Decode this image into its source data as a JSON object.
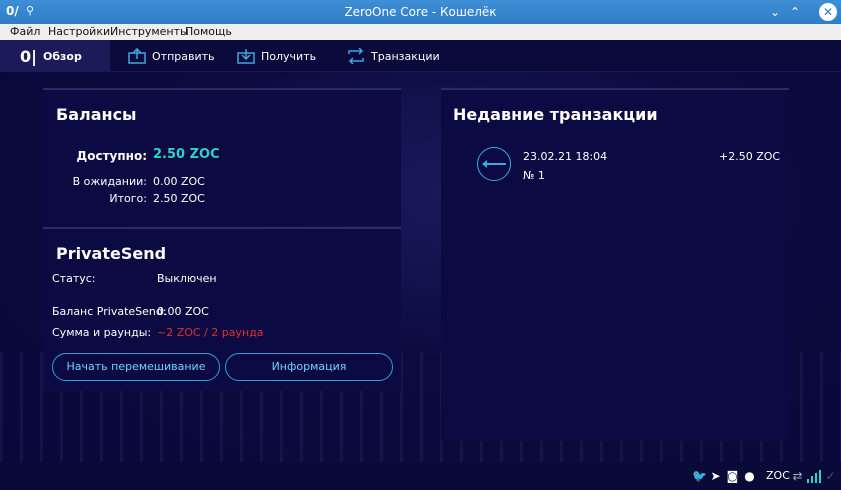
{
  "window": {
    "title": "ZeroOne Core - Кошелёк",
    "app_icon": "0/",
    "pin_icon": "pin-icon",
    "controls": [
      "minimize-icon",
      "maximize-icon",
      "close-icon"
    ]
  },
  "menu": {
    "items": [
      "Файл",
      "Настройки",
      "Инструменты",
      "Помощь"
    ]
  },
  "toolbar": {
    "tabs": [
      {
        "label": "Обзор",
        "icon": "logo-icon",
        "active": true
      },
      {
        "label": "Отправить",
        "icon": "send-icon"
      },
      {
        "label": "Получить",
        "icon": "receive-icon"
      },
      {
        "label": "Транзакции",
        "icon": "transactions-icon"
      }
    ]
  },
  "balances": {
    "title": "Балансы",
    "available_label": "Доступно:",
    "available_value": "2.50 ZOC",
    "pending_label": "В ожидании:",
    "pending_value": "0.00 ZOC",
    "total_label": "Итого:",
    "total_value": "2.50 ZOC"
  },
  "privatesend": {
    "title": "PrivateSend",
    "status_label": "Статус:",
    "status_value": "Выключен",
    "balance_label": "Баланс PrivateSend:",
    "balance_value": "0.00 ZOC",
    "amount_label": "Сумма и раунды:",
    "amount_value": "~2 ZOC / 2 раунда",
    "start_button": "Начать перемешивание",
    "info_button": "Информация"
  },
  "recent": {
    "title": "Недавние транзакции",
    "items": [
      {
        "date": "23.02.21 18:04",
        "amount": "+2.50 ZOC",
        "label": "№ 1",
        "icon": "incoming-arrow-icon"
      }
    ]
  },
  "status": {
    "unit": "ZOC",
    "icons": [
      "twitter-icon",
      "telegram-icon",
      "discord-icon",
      "github-icon",
      "network-icon",
      "connections-icon",
      "sync-check-icon"
    ]
  },
  "colors": {
    "accent": "#2ed3c6",
    "warning": "#e03030",
    "button_border": "#2e9fd6",
    "background": "#0b0b3a"
  }
}
